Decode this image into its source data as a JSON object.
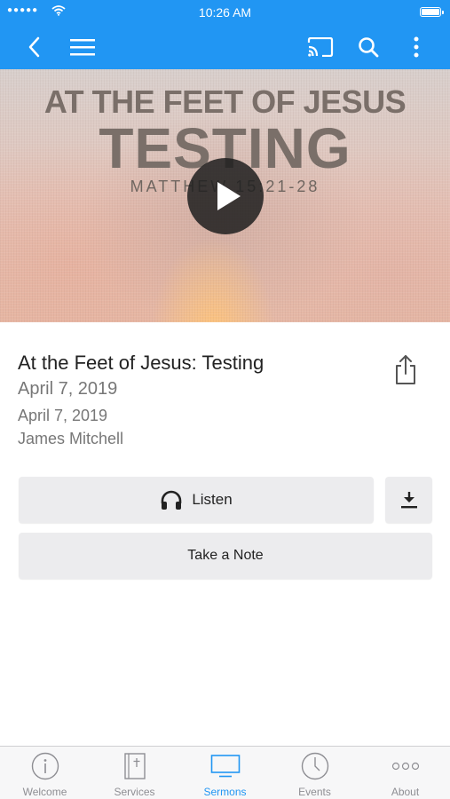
{
  "status_bar": {
    "time": "10:26 AM"
  },
  "navbar": {
    "icons": [
      "back-icon",
      "menu-icon",
      "cast-icon",
      "search-icon",
      "more-vertical-icon"
    ]
  },
  "hero": {
    "line1": "AT THE FEET OF JESUS",
    "line2": "TESTING",
    "line3": "MATTHEW 15:21-28"
  },
  "sermon": {
    "title": "At the Feet of Jesus: Testing",
    "date_primary": "April 7, 2019",
    "date_secondary": "April 7, 2019",
    "speaker": "James Mitchell"
  },
  "actions": {
    "listen_label": "Listen",
    "note_label": "Take a Note"
  },
  "tabs": [
    {
      "label": "Welcome",
      "icon": "info-icon"
    },
    {
      "label": "Services",
      "icon": "bible-icon"
    },
    {
      "label": "Sermons",
      "icon": "monitor-icon"
    },
    {
      "label": "Events",
      "icon": "clock-icon"
    },
    {
      "label": "About",
      "icon": "more-dots-icon"
    }
  ],
  "colors": {
    "primary": "#2196F3",
    "tab_inactive": "#8e8e93",
    "button_bg": "#ececee"
  }
}
